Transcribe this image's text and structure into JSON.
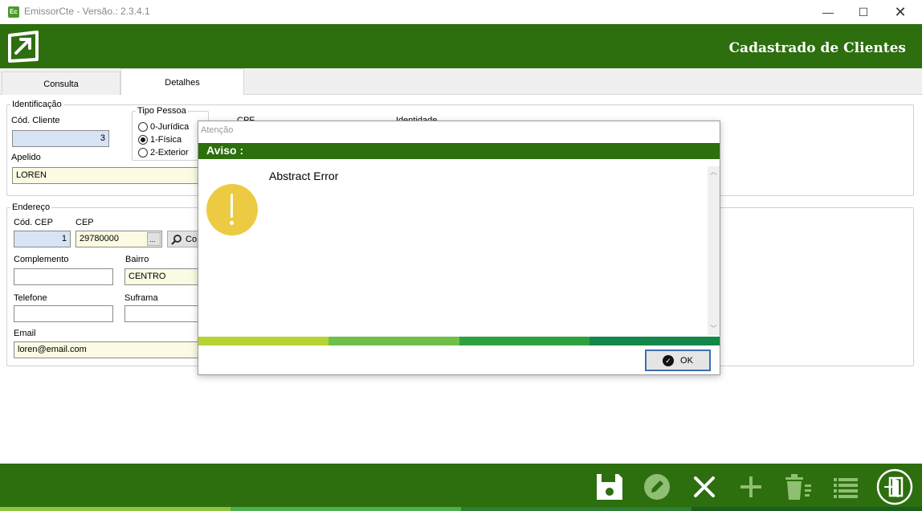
{
  "window": {
    "title": "EmissorCte - Versão.: 2.3.4.1",
    "minimize": "—",
    "maximize": "☐",
    "close": "✕"
  },
  "header": {
    "title": "Cadastrado de Clientes"
  },
  "tabs": [
    {
      "label": "Consulta"
    },
    {
      "label": "Detalhes"
    }
  ],
  "identificacao": {
    "legend": "Identificação",
    "cod_cliente_label": "Cód. Cliente",
    "cod_cliente_value": "3",
    "tipo_pessoa_legend": "Tipo Pessoa",
    "tipo_options": [
      {
        "label": "0-Jurídica",
        "checked": false
      },
      {
        "label": "1-Física",
        "checked": true
      },
      {
        "label": "2-Exterior",
        "checked": false
      }
    ],
    "apelido_label": "Apelido",
    "apelido_value": "LOREN",
    "cpf_label": "CPF",
    "identidade_label": "Identidade"
  },
  "endereco": {
    "legend": "Endereço",
    "cod_cep_label": "Cód. CEP",
    "cod_cep_value": "1",
    "cep_label": "CEP",
    "cep_value": "29780000",
    "cep_lookup": "...",
    "consultar_label": "Co",
    "complemento_label": "Complemento",
    "complemento_value": "",
    "bairro_label": "Bairro",
    "bairro_value": "CENTRO",
    "telefone_label": "Telefone",
    "telefone_value": "",
    "suframa_label": "Suframa",
    "suframa_value": "",
    "email_label": "Email",
    "email_value": "loren@email.com"
  },
  "dialog": {
    "title": "Atenção",
    "heading": "Aviso :",
    "message": "Abstract Error",
    "ok_label": "OK",
    "strip_colors": [
      "#b6d334",
      "#6fc04a",
      "#2ca23e",
      "#13884a"
    ]
  },
  "footer": {
    "buttons": [
      "save-icon",
      "edit-icon",
      "cancel-icon",
      "add-icon",
      "delete-icon",
      "list-icon",
      "exit-icon"
    ],
    "strip_colors": [
      "#8bc53f",
      "#4caf50",
      "#2e7d32",
      "#1b5e20"
    ]
  },
  "colors": {
    "brand_green": "#2d6e0e",
    "warning_yellow": "#eccb42",
    "readonly_blue": "#d6e4f5",
    "required_yellow": "#fbfbe3"
  }
}
